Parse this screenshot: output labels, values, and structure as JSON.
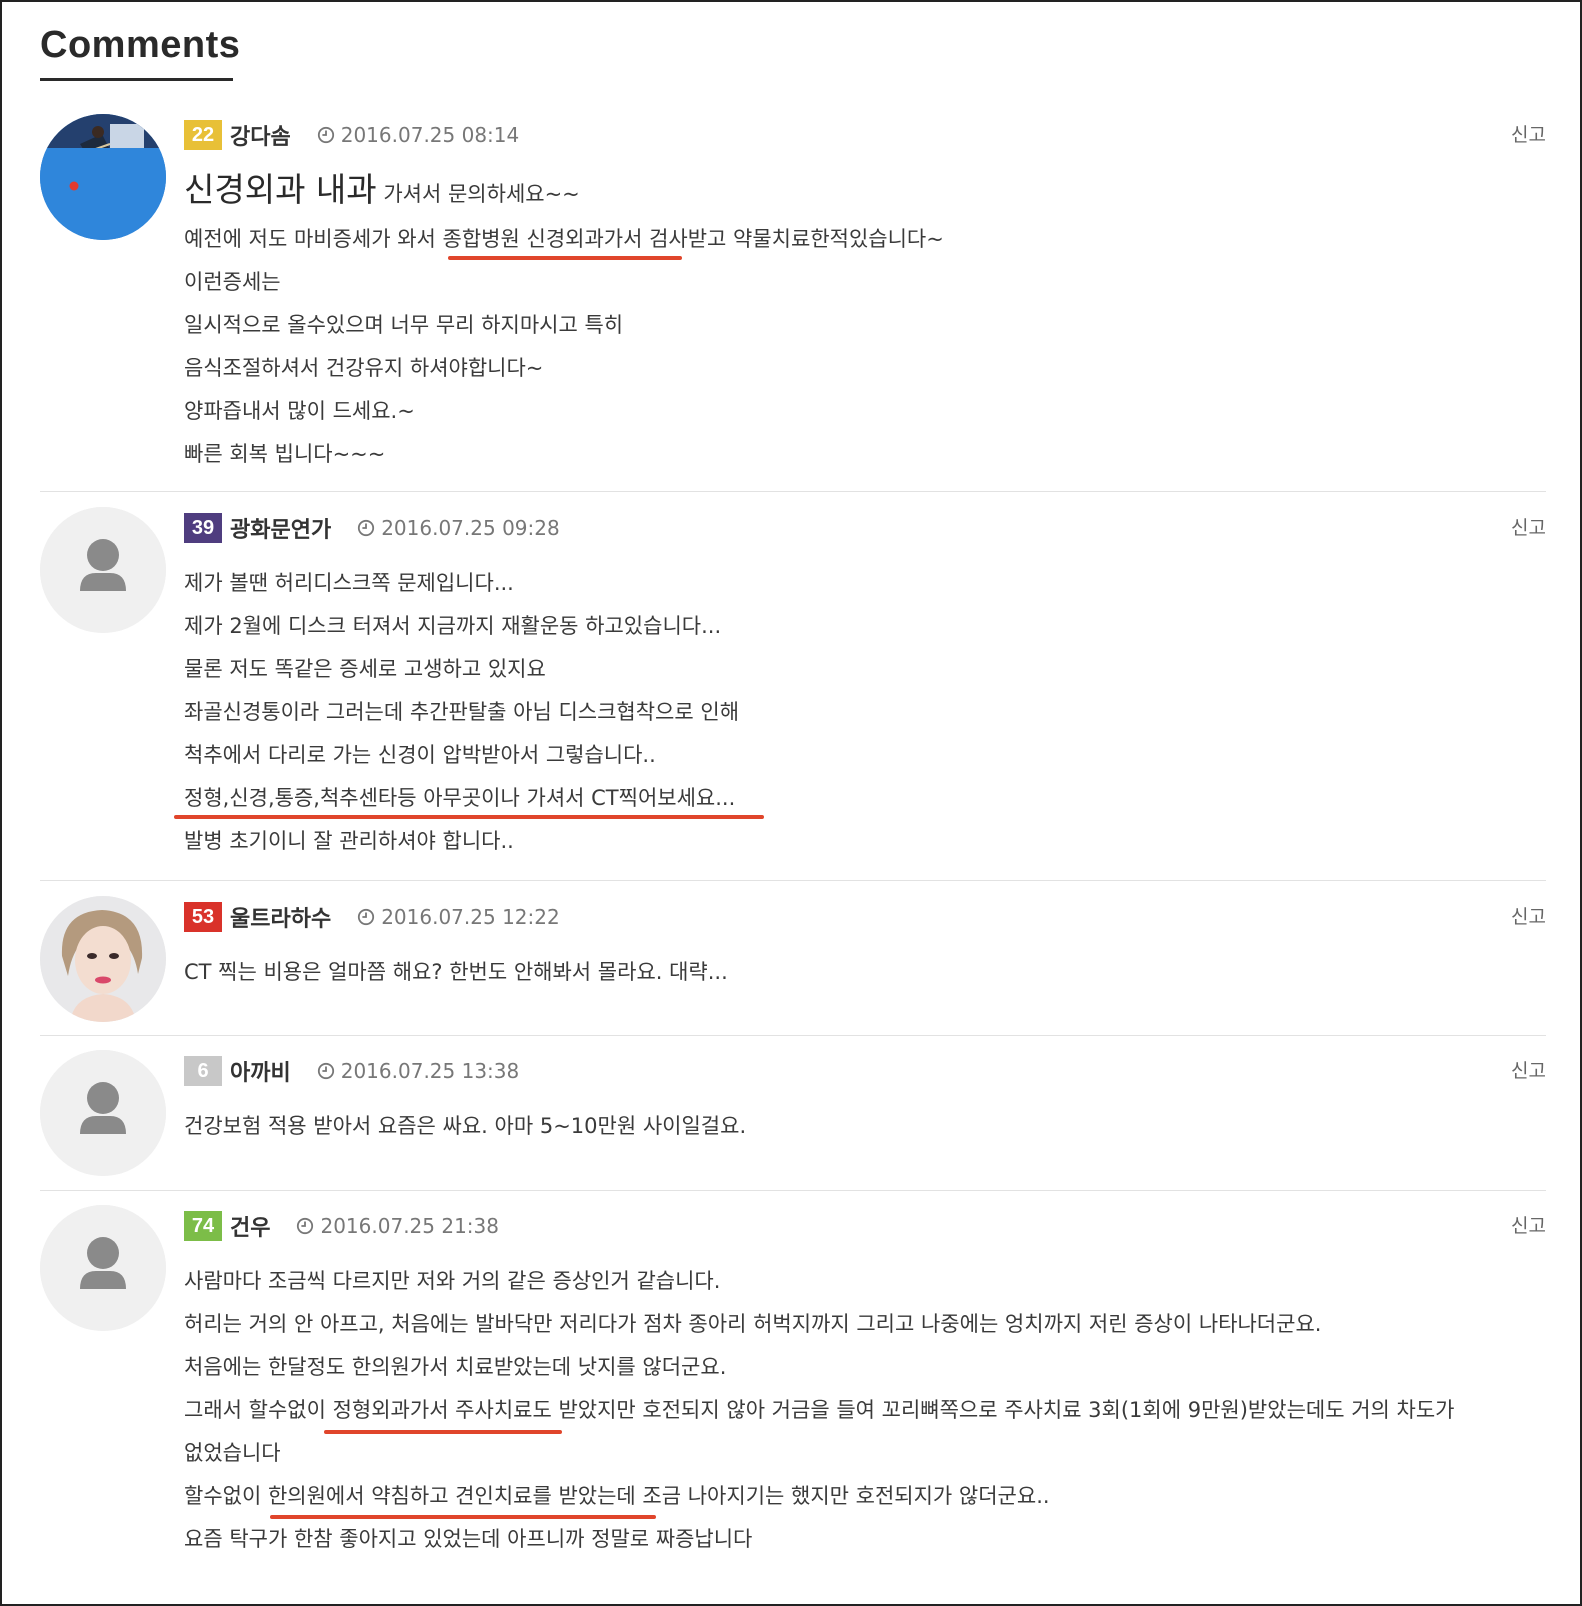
{
  "page": {
    "title": "Comments"
  },
  "colors": {
    "level_yellow": "#e8c037",
    "level_purple": "#4f3d7f",
    "level_red": "#d9322a",
    "level_gray": "#c8c8c8",
    "level_green": "#7cbd48",
    "underline": "#e0452b"
  },
  "icons": {
    "time": "clock-icon",
    "avatar_default": "user-silhouette-icon"
  },
  "comments": [
    {
      "level": "22",
      "nick": "강다솜",
      "time": "2016.07.25 08:14",
      "report": "신고",
      "headline_big": "신경외과 내과",
      "headline_small": "가셔서 문의하세요~~",
      "lines": [
        "예전에 저도 마비증세가 와서 종합병원 신경외과가서 검사받고 약물치료한적있습니다~",
        "이런증세는",
        "일시적으로 올수있으며 너무 무리 하지마시고 특히",
        "음식조절하셔서 건강유지 하셔야합니다~",
        "양파즙내서 많이 드세요.~",
        "빠른 회복 빕니다~~~"
      ]
    },
    {
      "level": "39",
      "nick": "광화문연가",
      "time": "2016.07.25 09:28",
      "report": "신고",
      "lines": [
        "제가 볼땐 허리디스크쪽 문제입니다...",
        "제가 2월에 디스크 터져서 지금까지 재활운동 하고있습니다...",
        "물론 저도 똑같은 증세로 고생하고 있지요",
        "좌골신경통이라 그러는데 추간판탈출 아님 디스크협착으로 인해",
        "척추에서 다리로 가는 신경이 압박받아서 그렇습니다..",
        "정형,신경,통증,척추센타등 아무곳이나 가셔서 CT찍어보세요...",
        "발병 초기이니 잘 관리하셔야 합니다.."
      ]
    },
    {
      "level": "53",
      "nick": "울트라하수",
      "time": "2016.07.25 12:22",
      "report": "신고",
      "lines": [
        "CT 찍는 비용은 얼마쯤 해요? 한번도 안해봐서 몰라요. 대략..."
      ]
    },
    {
      "level": "6",
      "nick": "아까비",
      "time": "2016.07.25 13:38",
      "report": "신고",
      "lines": [
        "건강보험 적용 받아서 요즘은 싸요. 아마 5~10만원 사이일걸요."
      ]
    },
    {
      "level": "74",
      "nick": "건우",
      "time": "2016.07.25 21:38",
      "report": "신고",
      "lines": [
        "사람마다 조금씩 다르지만 저와 거의 같은 증상인거 같습니다.",
        "허리는 거의 안 아프고, 처음에는 발바닥만 저리다가 점차 종아리 허벅지까지 그리고 나중에는 엉치까지 저린 증상이 나타나더군요.",
        "처음에는 한달정도 한의원가서 치료받았는데 낫지를 않더군요.",
        "그래서 할수없이 정형외과가서 주사치료도 받았지만 호전되지 않아 거금을 들여 꼬리뼈쪽으로 주사치료 3회(1회에 9만원)받았는데도 거의 차도가",
        "없었습니다",
        "할수없이 한의원에서 약침하고 견인치료를 받았는데 조금 나아지기는 했지만 호전되지가 않더군요..",
        "요즘 탁구가 한참 좋아지고 있었는데 아프니까 정말로 짜증납니다"
      ]
    }
  ]
}
